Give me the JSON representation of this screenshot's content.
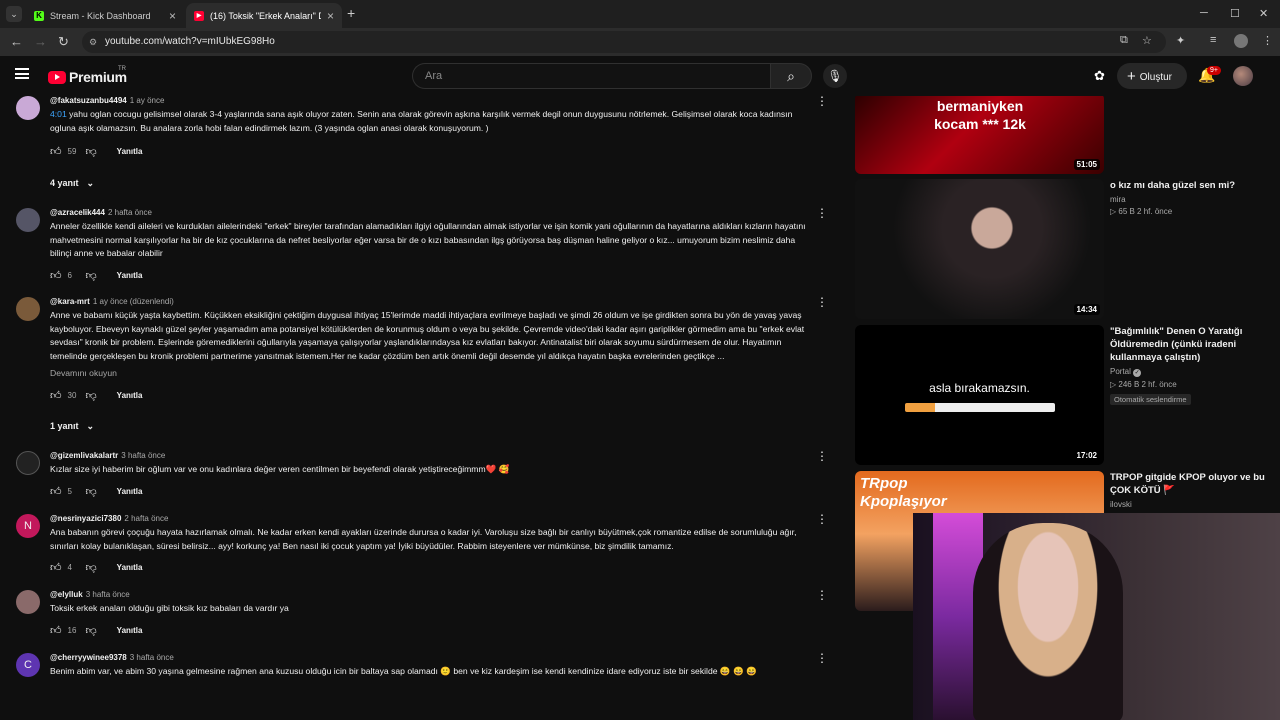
{
  "browser": {
    "tabs": [
      {
        "title": "Stream - Kick Dashboard",
        "active": false
      },
      {
        "title": "(16) Toksik \"Erkek Anaları\" Durum...",
        "active": true
      }
    ],
    "new_tab_symbol": "+",
    "url": "youtube.com/watch?v=mIUbkEG98Ho",
    "window_controls": [
      "minimize",
      "maximize",
      "close"
    ]
  },
  "masthead": {
    "logo_text": "Premium",
    "logo_region": "TR",
    "search_placeholder": "Ara",
    "create_label": "Oluştur",
    "notification_count": "9+"
  },
  "comments": [
    {
      "user": "@fakatsuzanbu4494",
      "time": "1 ay önce",
      "timestamp_link": "4:01",
      "text": " yahu oglan cocugu gelisimsel olarak 3-4 yaşlarında sana aşık oluyor zaten. Senin ana olarak görevin aşkına karşılık vermek degil onun duygusunu nötrlemek. Gelişimsel olarak koca kadınsın ogluna aşık olamazsın. Bu analara zorla hobi falan edindirmek lazım.  (3 yaşında oglan anasi olarak konuşuyorum. )",
      "likes": "59",
      "reply_label": "Yanıtla",
      "replies": "4 yanıt"
    },
    {
      "user": "@azracelik444",
      "time": "2 hafta önce",
      "text": "Anneler özellikle kendi aileleri ve kurdukları ailelerindeki \"erkek\" bireyler tarafından alamadıkları ilgiyi oğullarından almak istiyorlar ve işin komik yani oğullarının da hayatlarına aldıkları kızların hayatını mahvetmesini normal karşılıyorlar ha bir de kız çocuklarına da nefret besliyorlar eğer varsa bir de o kızı babasından ilgş görüyorsa baş düşman haline geliyor o kız... umuyorum bizim neslimiz daha bilinçi anne ve babalar olabilir",
      "likes": "6",
      "reply_label": "Yanıtla"
    },
    {
      "user": "@kara-mrt",
      "time": "1 ay önce (düzenlendi)",
      "text": "Anne ve babamı küçük yaşta kaybettim. Küçükken eksikliğini çektiğim duygusal ihtiyaç 15'lerimde maddi ihtiyaçlara evrilmeye başladı ve şimdi 26 oldum ve işe girdikten sonra bu yön de yavaş yavaş kayboluyor. Ebeveyn kaynaklı güzel şeyler yaşamadım ama potansiyel kötülüklerden de korunmuş oldum o veya bu şekilde. Çevremde video'daki kadar aşırı gariplikler görmedim ama bu \"erkek evlat sevdası\" kronik bir problem. Eşlerinde göremediklerini oğullarıyla yaşamaya çalışıyorlar yaşlandıklarındaysa kız evlatları bakıyor. Antinatalist biri olarak soyumu sürdürmesem de olur. Hayatımın temelinde gerçekleşen bu kronik problemi partnerime yansıtmak istemem.Her ne kadar çözdüm ben artık önemli değil desemde yıl aldıkça hayatın başka evrelerinden geçtikçe ...",
      "more_label": "Devamını okuyun",
      "likes": "30",
      "reply_label": "Yanıtla",
      "replies": "1 yanıt"
    },
    {
      "user": "@gizemlivakalartr",
      "time": "3 hafta önce",
      "text": "Kızlar size iyi haberim bir oğlum var ve onu kadınlara değer veren centilmen bir beyefendi olarak yetiştireceğimmm❤️ 🥰",
      "likes": "5",
      "reply_label": "Yanıtla"
    },
    {
      "user": "@nesrinyazici7380",
      "time": "2 hafta önce",
      "avatar_letter": "N",
      "text": "Ana babanın görevi çoçuğu hayata hazırlamak olmalı. Ne kadar erken kendi ayakları üzerinde durursa o kadar iyi. Varoluşu size bağlı bir canlıyı büyütmek,çok romantize edilse de sorumluluğu ağır, sınırları kolay bulanıklaşan, süresi belirsiz... ayy! korkunç ya! Ben nasıl iki çocuk yaptım ya! İyiki büyüdüler. Rabbim isteyenlere ver mümkünse, biz şimdilik tamamız.",
      "likes": "4",
      "reply_label": "Yanıtla"
    },
    {
      "user": "@elylluk",
      "time": "3 hafta önce",
      "text": "Toksik erkek anaları olduğu gibi toksik kız babaları da vardır ya",
      "likes": "16",
      "reply_label": "Yanıtla"
    },
    {
      "user": "@cherryywinee9378",
      "time": "3 hafta önce",
      "avatar_letter": "C",
      "text": "Benim abim var, ve abim 30 yaşına gelmesine rağmen ana kuzusu olduğu icin bir baltaya sap olamadı 🙂 ben ve kiz kardeşim ise kendi kendinize idare ediyoruz iste bir sekilde 😄 😄 😄"
    }
  ],
  "recommendations": [
    {
      "thumb_text": "bermaniyken kocam *** 12k",
      "duration": "51:05"
    },
    {
      "title": "o kız mı daha güzel sen mi?",
      "channel": "mira",
      "meta": "▷ 65 B   2 hf. önce",
      "duration": "14:34"
    },
    {
      "title": "\"Bağımlılık\" Denen O Yaratığı Öldüremedin (çünkü iradeni kullanmaya çalıştın)",
      "channel": "Portal",
      "meta": "▷ 246 B   2 hf. önce",
      "badge": "Otomatik seslendirme",
      "thumb_text": "asla bırakamazsın.",
      "duration": "17:02"
    },
    {
      "title": "TRPOP gitgide KPOP oluyor ve bu ÇOK KÖTÜ 🚩",
      "channel": "ilovski",
      "thumb_text": "TRpop Kpoplaşıyor"
    }
  ],
  "colors": {
    "accent": "#ff0033",
    "link": "#3ea6ff",
    "bg": "#0f0f0f"
  }
}
